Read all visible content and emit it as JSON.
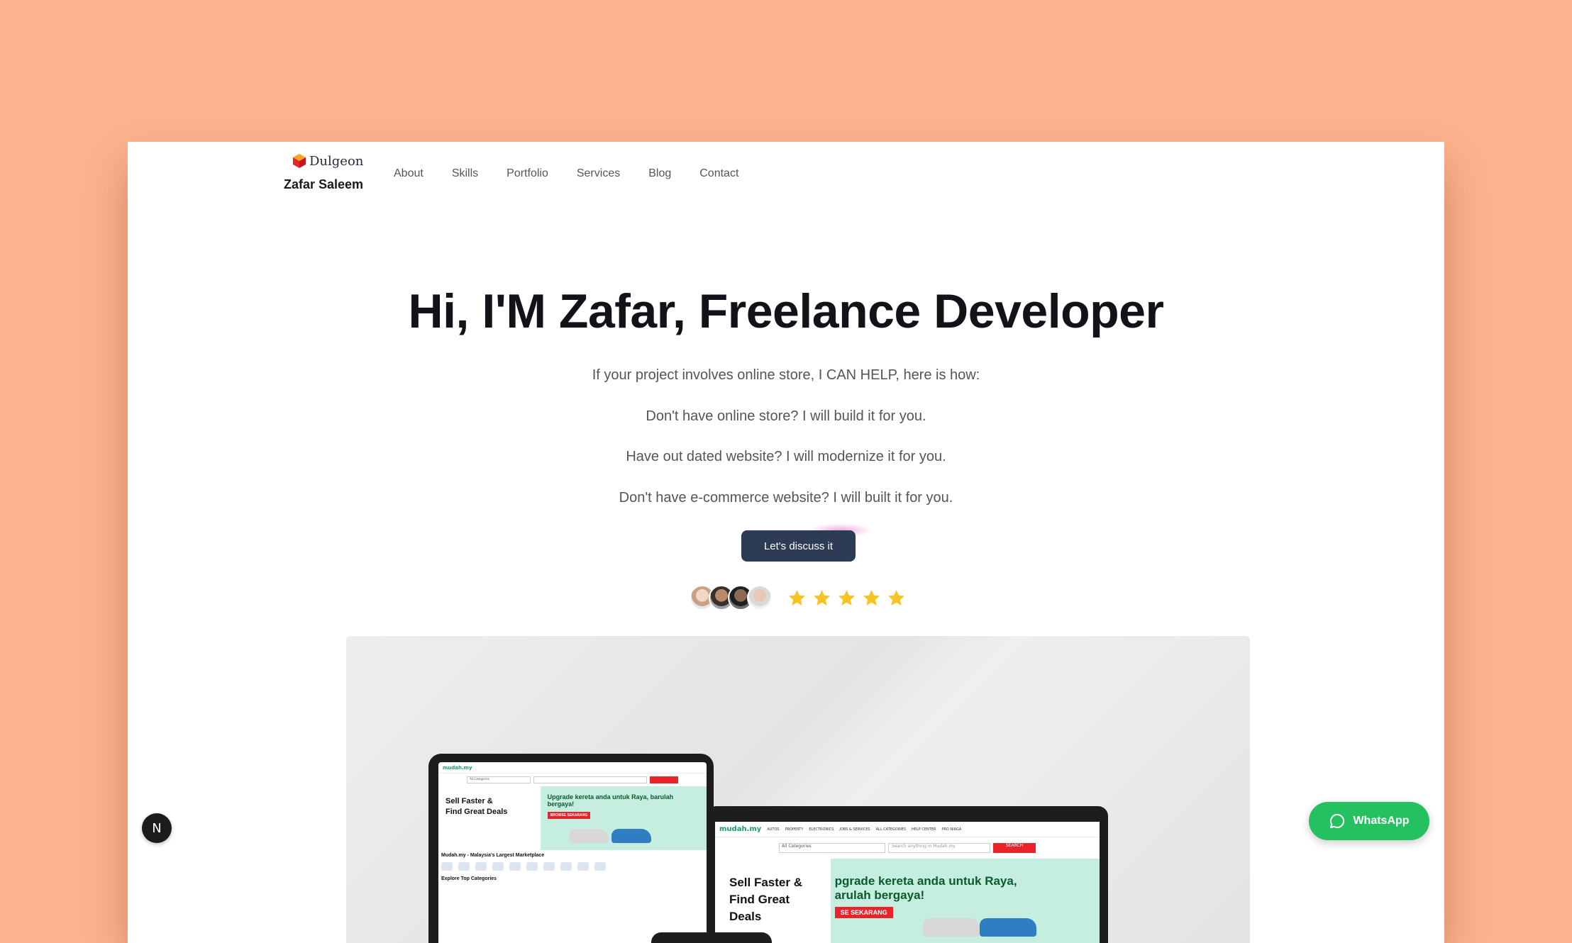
{
  "brand": {
    "logo_text": "Dulgeon",
    "name": "Zafar Saleem"
  },
  "nav": {
    "items": [
      "About",
      "Skills",
      "Portfolio",
      "Services",
      "Blog",
      "Contact"
    ]
  },
  "hero": {
    "title": "Hi, I'M Zafar, Freelance Developer",
    "lines": [
      "If your project involves online store, I CAN HELP, here is how:",
      "Don't have online store? I will build it for you.",
      "Have out dated website? I will modernize it for you.",
      "Don't have e-commerce website? I will built it for you."
    ],
    "cta_label": "Let's discuss it"
  },
  "rating": {
    "avatar_count": 4,
    "stars": 5,
    "star_color": "#f7c325"
  },
  "mockup": {
    "site_logo": "mudah.my",
    "categories_label": "All Categories",
    "tablet": {
      "headline_1": "Sell Faster &",
      "headline_2": "Find Great Deals",
      "promo": "Upgrade kereta anda untuk Raya, barulah bergaya!",
      "promo_button": "BROWSE SEKARANG",
      "marketplace": "Mudah.my - Malaysia's Largest Marketplace",
      "explore": "Explore Top Categories"
    },
    "laptop": {
      "nav": [
        "AUTOS",
        "PROPERTY",
        "ELECTRONICS",
        "JOBS & SERVICES",
        "ALL CATEGORIES",
        "HELP CENTER",
        "PRO NIAGA"
      ],
      "search_placeholder": "Search anything in Mudah.my",
      "search_button": "SEARCH",
      "headline_1": "Sell Faster &",
      "headline_2": "Find Great Deals",
      "promo": "pgrade kereta anda untuk Raya, arulah bergaya!",
      "promo_button": "SE SEKARANG"
    }
  },
  "widgets": {
    "next_badge": "N",
    "whatsapp_label": "WhatsApp"
  },
  "colors": {
    "page_bg": "#fdb38e",
    "cta_bg": "#2d3b55",
    "whatsapp": "#25c160",
    "mudah_green": "#1aa260"
  }
}
